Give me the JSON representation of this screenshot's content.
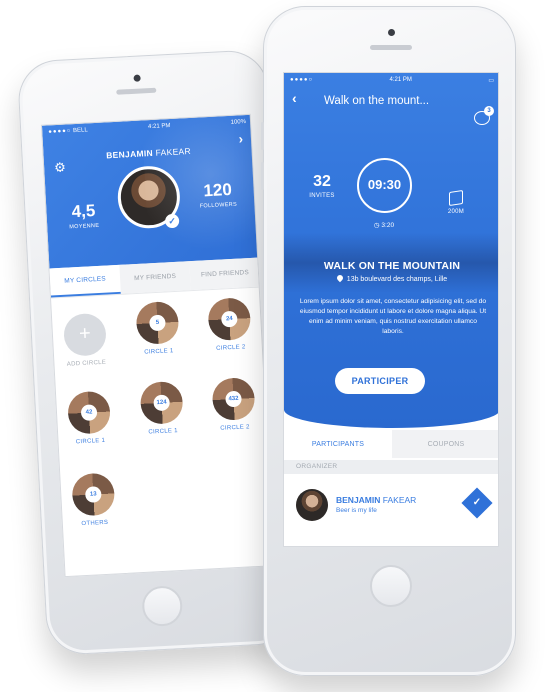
{
  "left_phone": {
    "status": {
      "carrier": "BELL",
      "time": "4:21 PM",
      "battery": "100%"
    },
    "profile": {
      "first_name": "BENJAMIN",
      "last_name": "FAKEAR",
      "rating": "4,5",
      "rating_label": "MOYENNE",
      "followers": "120",
      "followers_label": "FOLLOWERS"
    },
    "tabs": [
      {
        "label": "MY CIRCLES",
        "active": true
      },
      {
        "label": "MY FRIENDS",
        "active": false
      },
      {
        "label": "FIND FRIENDS",
        "active": false
      }
    ],
    "circles": [
      {
        "label": "ADD CIRCLE",
        "count": ""
      },
      {
        "label": "CIRCLE 1",
        "count": "5"
      },
      {
        "label": "CIRCLE 2",
        "count": "24"
      },
      {
        "label": "CIRCLE 1",
        "count": "42"
      },
      {
        "label": "CIRCLE 1",
        "count": "124"
      },
      {
        "label": "CIRCLE 2",
        "count": "432"
      },
      {
        "label": "OTHERS",
        "count": "13"
      }
    ]
  },
  "right_phone": {
    "status": {
      "time": "4:21 PM"
    },
    "header_title": "Walk on the mount...",
    "notification_count": "3",
    "invites": "32",
    "invites_label": "INVITES",
    "time": "09:30",
    "duration": "3:20",
    "distance": "200M",
    "event_name": "WALK ON THE MOUNTAIN",
    "address": "13b boulevard des champs, Lille",
    "description": "Lorem ipsum dolor sit amet, consectetur adipisicing elit, sed do eiusmod tempor incididunt ut labore et dolore magna aliqua. Ut enim ad minim veniam, quis nostrud exercitation ullamco laboris.",
    "cta_label": "PARTICIPER",
    "tabs": [
      {
        "label": "PARTICIPANTS",
        "active": true
      },
      {
        "label": "COUPONS",
        "active": false
      }
    ],
    "section_label": "ORGANIZER",
    "organizer": {
      "first_name": "BENJAMIN",
      "last_name": "FAKEAR",
      "tagline": "Beer is my life"
    }
  }
}
